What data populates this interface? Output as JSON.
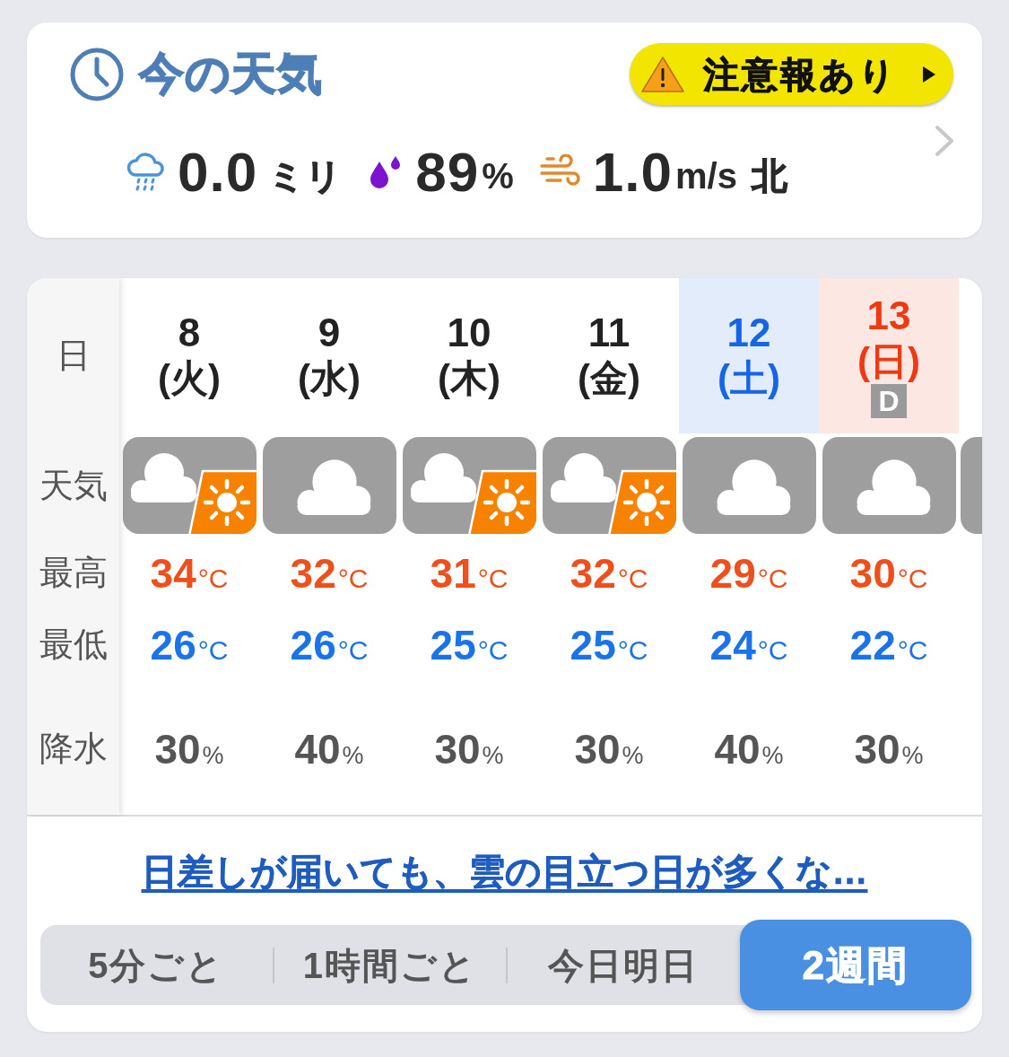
{
  "now": {
    "title": "今の天気",
    "alert": {
      "label": "注意報あり"
    },
    "readings": [
      {
        "kind": "rain",
        "value": "0.0",
        "unit": "ミリ"
      },
      {
        "kind": "humidity",
        "value": "89",
        "unit": "%"
      },
      {
        "kind": "wind",
        "value": "1.0",
        "unit": "m/s",
        "direction": "北"
      }
    ]
  },
  "forecast": {
    "row_labels": [
      "日",
      "天気",
      "最高",
      "最低",
      "降水"
    ],
    "days": [
      {
        "kind": "weekday",
        "date": "8",
        "weekday": "(火)",
        "weather": {
          "kind": "suncloud"
        },
        "high": {
          "value": "34",
          "unit": "°C"
        },
        "low": {
          "value": "26",
          "unit": "°C"
        },
        "precip": {
          "value": "30",
          "unit": "%"
        }
      },
      {
        "kind": "weekday",
        "date": "9",
        "weekday": "(水)",
        "weather": {
          "kind": "cloudy"
        },
        "high": {
          "value": "32",
          "unit": "°C"
        },
        "low": {
          "value": "26",
          "unit": "°C"
        },
        "precip": {
          "value": "40",
          "unit": "%"
        }
      },
      {
        "kind": "weekday",
        "date": "10",
        "weekday": "(木)",
        "weather": {
          "kind": "suncloud"
        },
        "high": {
          "value": "31",
          "unit": "°C"
        },
        "low": {
          "value": "25",
          "unit": "°C"
        },
        "precip": {
          "value": "30",
          "unit": "%"
        }
      },
      {
        "kind": "weekday",
        "date": "11",
        "weekday": "(金)",
        "weather": {
          "kind": "suncloud"
        },
        "high": {
          "value": "32",
          "unit": "°C"
        },
        "low": {
          "value": "25",
          "unit": "°C"
        },
        "precip": {
          "value": "30",
          "unit": "%"
        }
      },
      {
        "kind": "saturday",
        "date": "12",
        "weekday": "(土)",
        "weather": {
          "kind": "cloudy"
        },
        "high": {
          "value": "29",
          "unit": "°C"
        },
        "low": {
          "value": "24",
          "unit": "°C"
        },
        "precip": {
          "value": "40",
          "unit": "%"
        }
      },
      {
        "kind": "sunday",
        "date": "13",
        "weekday": "(日)",
        "badge": "D",
        "weather": {
          "kind": "cloudy"
        },
        "high": {
          "value": "30",
          "unit": "°C"
        },
        "low": {
          "value": "22",
          "unit": "°C"
        },
        "precip": {
          "value": "30",
          "unit": "%"
        }
      }
    ],
    "more_days_peek": true,
    "summary_link": "日差しが届いても、雲の目立つ日が多くな…"
  },
  "tabs": [
    {
      "label": "5分ごと",
      "selected": false
    },
    {
      "label": "1時間ごと",
      "selected": false
    },
    {
      "label": "今日明日",
      "selected": false
    },
    {
      "label": "2週間",
      "selected": true
    }
  ]
}
